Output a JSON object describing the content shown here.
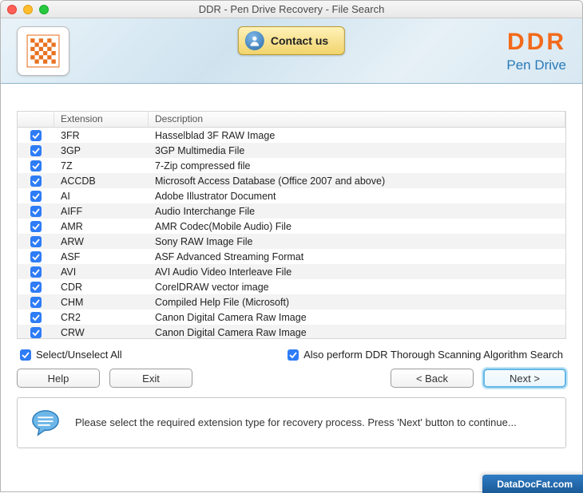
{
  "window": {
    "title": "DDR - Pen Drive Recovery - File Search"
  },
  "header": {
    "contact_label": "Contact us",
    "brand_name": "DDR",
    "brand_sub": "Pen Drive"
  },
  "table": {
    "columns": {
      "checkbox": "",
      "extension": "Extension",
      "description": "Description"
    },
    "rows": [
      {
        "ext": "3FR",
        "desc": "Hasselblad 3F RAW Image"
      },
      {
        "ext": "3GP",
        "desc": "3GP Multimedia File"
      },
      {
        "ext": "7Z",
        "desc": "7-Zip compressed file"
      },
      {
        "ext": "ACCDB",
        "desc": "Microsoft Access Database (Office 2007 and above)"
      },
      {
        "ext": "AI",
        "desc": "Adobe Illustrator Document"
      },
      {
        "ext": "AIFF",
        "desc": "Audio Interchange File"
      },
      {
        "ext": "AMR",
        "desc": "AMR Codec(Mobile Audio) File"
      },
      {
        "ext": "ARW",
        "desc": "Sony RAW Image File"
      },
      {
        "ext": "ASF",
        "desc": "ASF Advanced Streaming Format"
      },
      {
        "ext": "AVI",
        "desc": "AVI Audio Video Interleave File"
      },
      {
        "ext": "CDR",
        "desc": "CorelDRAW vector image"
      },
      {
        "ext": "CHM",
        "desc": "Compiled Help File (Microsoft)"
      },
      {
        "ext": "CR2",
        "desc": "Canon Digital Camera Raw Image"
      },
      {
        "ext": "CRW",
        "desc": "Canon Digital Camera Raw Image"
      }
    ]
  },
  "controls": {
    "select_all_label": "Select/Unselect All",
    "thorough_label": "Also perform DDR Thorough Scanning Algorithm Search",
    "help_label": "Help",
    "exit_label": "Exit",
    "back_label": "< Back",
    "next_label": "Next >"
  },
  "info": {
    "text": "Please select the required extension type for recovery process. Press 'Next' button to continue..."
  },
  "watermark": "DataDocFat.com"
}
